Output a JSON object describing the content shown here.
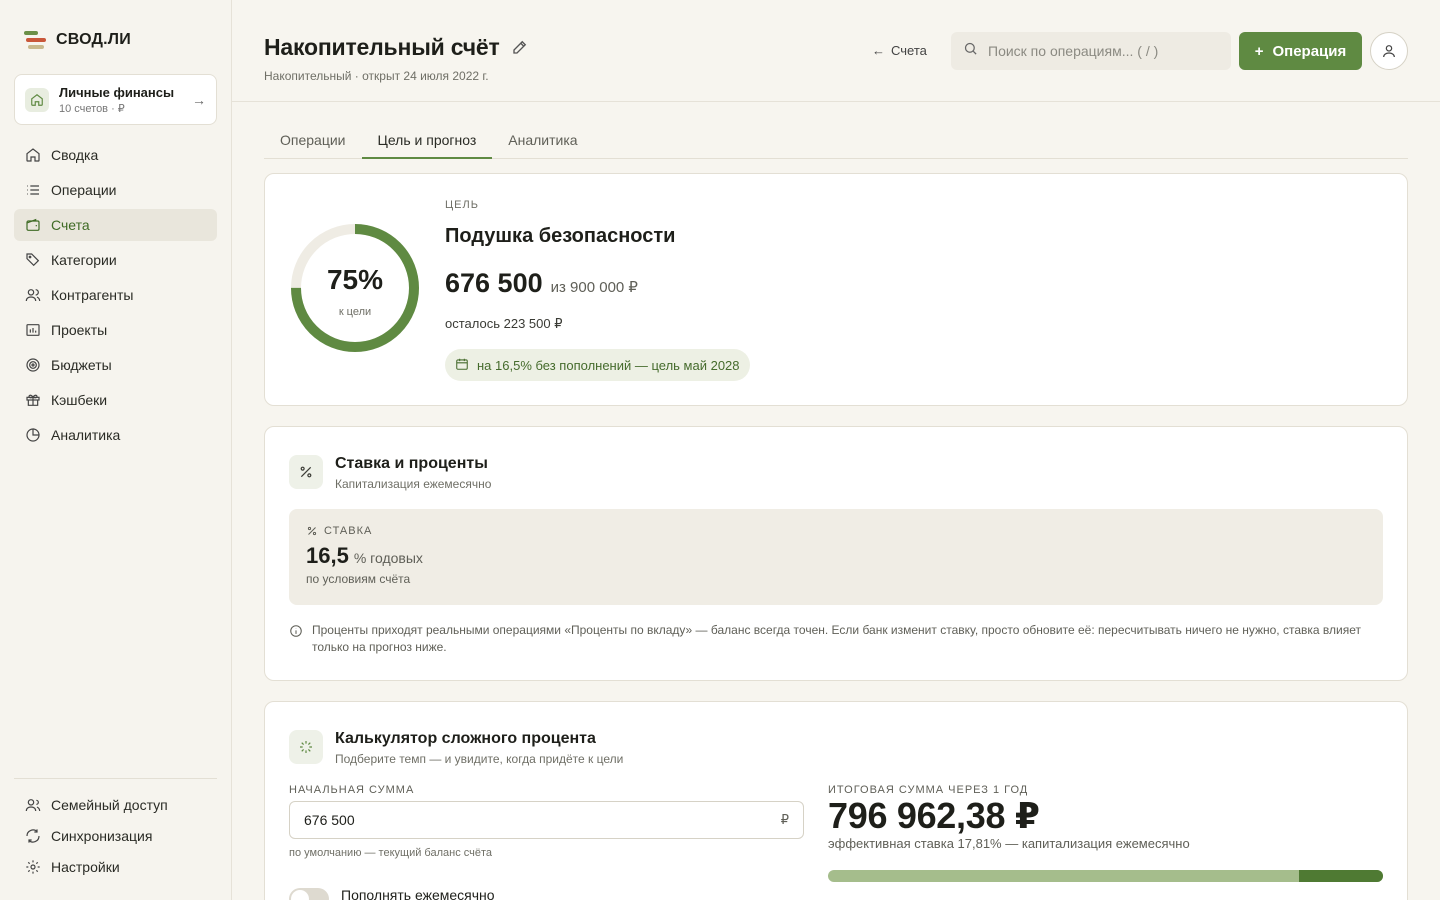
{
  "app": {
    "name": "СВОД.ЛИ"
  },
  "workspace": {
    "title": "Личные финансы",
    "subtitle": "10 счетов · ₽"
  },
  "sidebar": {
    "items": [
      {
        "label": "Сводка",
        "icon": "home-icon"
      },
      {
        "label": "Операции",
        "icon": "list-icon"
      },
      {
        "label": "Счета",
        "icon": "wallet-icon",
        "active": true
      },
      {
        "label": "Категории",
        "icon": "tag-icon"
      },
      {
        "label": "Контрагенты",
        "icon": "users-icon"
      },
      {
        "label": "Проекты",
        "icon": "chart-bar-icon"
      },
      {
        "label": "Бюджеты",
        "icon": "target-icon"
      },
      {
        "label": "Кэшбеки",
        "icon": "gift-icon"
      },
      {
        "label": "Аналитика",
        "icon": "pie-chart-icon"
      }
    ],
    "bottom": [
      {
        "label": "Семейный доступ",
        "icon": "family-icon"
      },
      {
        "label": "Синхронизация",
        "icon": "sync-icon"
      },
      {
        "label": "Настройки",
        "icon": "gear-icon"
      }
    ]
  },
  "header": {
    "title": "Накопительный счёт",
    "subtitle": "Накопительный · открыт 24 июля 2022 г.",
    "back_label": "Счета",
    "search_placeholder": "Поиск по операциям... ( / )",
    "add_label": "Операция"
  },
  "tabs": [
    {
      "label": "Операции"
    },
    {
      "label": "Цель и прогноз",
      "active": true
    },
    {
      "label": "Аналитика"
    }
  ],
  "goal": {
    "eyebrow": "ЦЕЛЬ",
    "name": "Подушка безопасности",
    "progress_pct": "75%",
    "progress_fraction": 0.75,
    "progress_label": "к цели",
    "amount": "676 500",
    "target": "из 900 000 ₽",
    "remaining": "осталось 223 500 ₽",
    "forecast": "на 16,5% без пополнений — цель май 2028"
  },
  "rate": {
    "title": "Ставка и проценты",
    "subtitle": "Капитализация ежемесячно",
    "eyebrow": "СТАВКА",
    "value": "16,5",
    "unit": "% годовых",
    "note": "по условиям счёта",
    "info": "Проценты приходят реальными операциями «Проценты по вкладу» — баланс всегда точен. Если банк изменит ставку, просто обновите её: пересчитывать ничего не нужно, ставка влияет только на прогноз ниже."
  },
  "calculator": {
    "title": "Калькулятор сложного процента",
    "subtitle": "Подберите темп — и увидите, когда придёте к цели",
    "initial_label": "НАЧАЛЬНАЯ СУММА",
    "initial_value": "676 500",
    "currency": "₽",
    "initial_hint": "по умолчанию — текущий баланс счёта",
    "toggle_label": "Пополнять ежемесячно",
    "result_label": "ИТОГОВАЯ СУММА ЧЕРЕЗ 1 ГОД",
    "result_value": "796 962,38 ₽",
    "result_note": "эффективная ставка 17,81% — капитализация ежемесячно",
    "interest_share": 0.151
  },
  "colors": {
    "accent": "#5f8a42",
    "accent_dark": "#4f7a33",
    "accent_light": "#a5bd8c",
    "background": "#f7f5ef"
  }
}
